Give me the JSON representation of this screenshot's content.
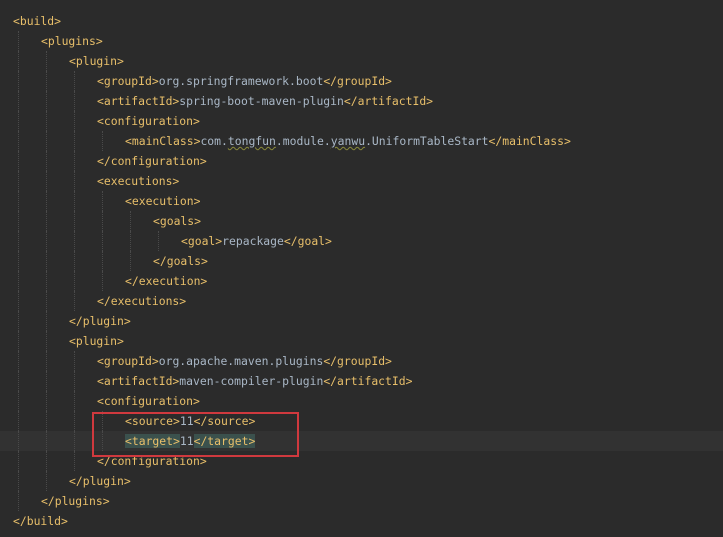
{
  "editor": {
    "lines": [
      {
        "indent": 0,
        "open": "<build>",
        "value": "",
        "close": ""
      },
      {
        "indent": 1,
        "open": "<plugins>",
        "value": "",
        "close": ""
      },
      {
        "indent": 2,
        "open": "<plugin>",
        "value": "",
        "close": ""
      },
      {
        "indent": 3,
        "open": "<groupId>",
        "value": "org.springframework.boot",
        "close": "</groupId>"
      },
      {
        "indent": 3,
        "open": "<artifactId>",
        "value": "spring-boot-maven-plugin",
        "close": "</artifactId>"
      },
      {
        "indent": 3,
        "open": "<configuration>",
        "value": "",
        "close": ""
      },
      {
        "indent": 4,
        "open": "<mainClass>",
        "value_parts": [
          "com.",
          "tongfun",
          ".module.",
          "yanwu",
          ".UniformTableStart"
        ],
        "close": "</mainClass>"
      },
      {
        "indent": 3,
        "open": "</configuration>",
        "value": "",
        "close": ""
      },
      {
        "indent": 3,
        "open": "<executions>",
        "value": "",
        "close": ""
      },
      {
        "indent": 4,
        "open": "<execution>",
        "value": "",
        "close": ""
      },
      {
        "indent": 5,
        "open": "<goals>",
        "value": "",
        "close": ""
      },
      {
        "indent": 6,
        "open": "<goal>",
        "value": "repackage",
        "close": "</goal>"
      },
      {
        "indent": 5,
        "open": "</goals>",
        "value": "",
        "close": ""
      },
      {
        "indent": 4,
        "open": "</execution>",
        "value": "",
        "close": ""
      },
      {
        "indent": 3,
        "open": "</executions>",
        "value": "",
        "close": ""
      },
      {
        "indent": 2,
        "open": "</plugin>",
        "value": "",
        "close": ""
      },
      {
        "indent": 2,
        "open": "<plugin>",
        "value": "",
        "close": ""
      },
      {
        "indent": 3,
        "open": "<groupId>",
        "value": "org.apache.maven.plugins",
        "close": "</groupId>"
      },
      {
        "indent": 3,
        "open": "<artifactId>",
        "value": "maven-compiler-plugin",
        "close": "</artifactId>"
      },
      {
        "indent": 3,
        "open": "<configuration>",
        "value": "",
        "close": ""
      },
      {
        "indent": 4,
        "open": "<source>",
        "value": "11",
        "close": "</source>"
      },
      {
        "indent": 4,
        "open": "<target>",
        "value": "11",
        "close": "</target>"
      },
      {
        "indent": 3,
        "open": "</configuration>",
        "value": "",
        "close": ""
      },
      {
        "indent": 2,
        "open": "</plugin>",
        "value": "",
        "close": ""
      },
      {
        "indent": 1,
        "open": "</plugins>",
        "value": "",
        "close": ""
      },
      {
        "indent": 0,
        "open": "</build>",
        "value": "",
        "close": ""
      }
    ],
    "current_line": 21,
    "highlighted_lines": [
      20,
      21
    ],
    "colors": {
      "background": "#2b2b2b",
      "tag": "#e8bf6a",
      "text": "#a9b7c6",
      "current_line": "#323232",
      "tag_match": "#3b514d",
      "annotation_box": "#d0393e"
    }
  }
}
